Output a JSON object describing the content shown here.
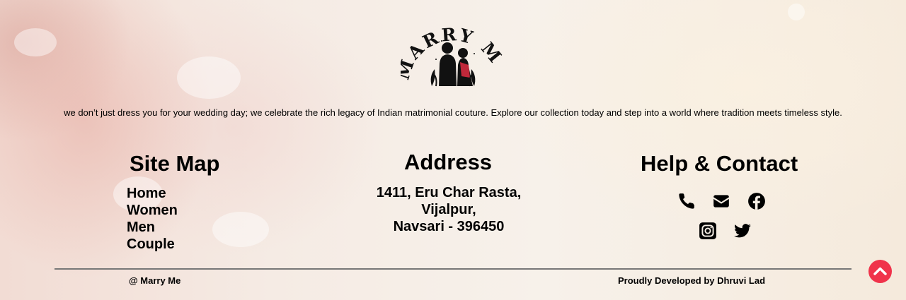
{
  "brand": {
    "logo_text": "MARRY ME"
  },
  "tagline": "we don’t just dress you for your wedding day; we celebrate the rich legacy of Indian matrimonial couture. Explore our collection today and step into a world where tradition meets timeless style.",
  "sitemap": {
    "title": "Site Map",
    "items": [
      "Home",
      "Women",
      "Men",
      "Couple"
    ]
  },
  "address": {
    "title": "Address",
    "lines": [
      "1411, Eru Char Rasta,",
      "Vijalpur,",
      "Navsari - 396450"
    ]
  },
  "help": {
    "title": "Help & Contact",
    "icons": [
      "phone-icon",
      "mail-icon",
      "facebook-icon",
      "instagram-icon",
      "twitter-icon"
    ]
  },
  "footer": {
    "copyright": "@ Marry Me",
    "credit": "Proudly Developed by Dhruvi Lad"
  },
  "colors": {
    "accent": "#f0334b",
    "logo_red": "#c0283a",
    "text": "#000000"
  }
}
